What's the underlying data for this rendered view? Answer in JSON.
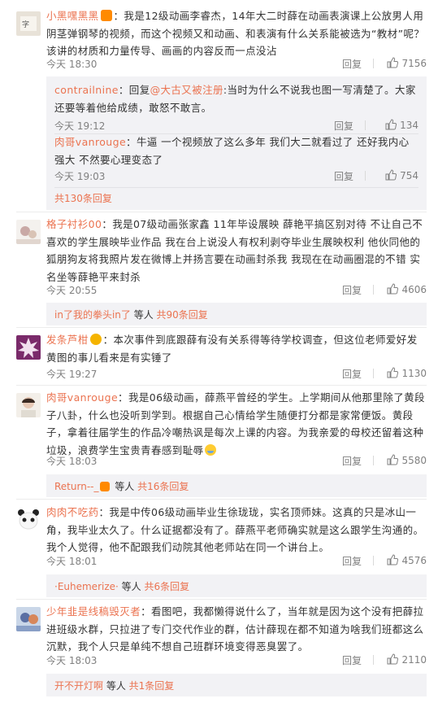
{
  "comments": [
    {
      "author": "小黑嘿黑黑",
      "text": "：我是12级动画李睿杰，14年大二时薛在动画表演课上公放男人用阴茎弹钢琴的视频，而这个视频又和动画、和表演有什么关系能被选为“教材”呢？该讲的材质和力量传导、画画的内容反而一点没沾",
      "time": "今天 18:30",
      "reply_label": "回复",
      "likes": "7156",
      "replies": [
        {
          "author": "contrailnine",
          "text": "：回复",
          "mention": "@大古又被注册",
          "text2": ":当时为什么不说我也图一写清楚了。大家还要等着他给成绩，敢怒不敢言。",
          "time": "今天 19:12",
          "reply_label": "回复",
          "likes": "134"
        },
        {
          "author": "肉哥vanrouge",
          "text": "：牛逼 一个视频放了这么多年 我们大二就看过了 还好我内心强大 不然要心理变态了",
          "time": "今天 19:03",
          "reply_label": "回复",
          "likes": "754"
        }
      ],
      "more": "共130条回复"
    },
    {
      "author": "格子衬衫00",
      "text": "：我是07级动画张家鑫 11年毕设展映 薛艳平搞区别对待 不让自己不喜欢的学生展映毕业作品 我在台上说没人有权利剥夺毕业生展映权利 他伙同他的狐朋狗友将我照片发在微博上并扬言要在动画封杀我 我现在在动画圈混的不错 实名坐等薛艳平来封杀",
      "time": "今天 20:55",
      "reply_label": "回复",
      "likes": "4606",
      "more_prefix": "in了我的拳头in了",
      "more_mid": " 等人 ",
      "more": "共90条回复"
    },
    {
      "author": "发条芦柑",
      "text": "：本次事件到底跟薛有没有关系得等待学校调查，但这位老师爱好发黄图的事儿看来是有实锤了",
      "time": "今天 19:27",
      "reply_label": "回复",
      "likes": "1130"
    },
    {
      "author": "肉哥vanrouge",
      "text": "：我是06级动画，薛燕平曾经的学生。上学期间从他那里除了黄段子八卦，什么也没听到学到。根据自己心情给学生随便打分都是家常便饭。黄段子，拿着往届学生的作品冷嘲热讽是每次上课的内容。为我亲爱的母校还留着这种垃圾，浪费学生宝贵青春感到耻辱",
      "time": "今天 18:03",
      "reply_label": "回复",
      "likes": "5580",
      "more_prefix": "Return--_",
      "more_mid": " 等人 ",
      "more": "共16条回复"
    },
    {
      "author": "肉肉不吃药",
      "text": "：我是中传06级动画毕业生徐珑珑，实名顶师妹。这真的只是冰山一角，我毕业太久了。什么证据都没有了。薛燕平老师确实就是这么跟学生沟通的。我个人觉得，他不配跟我们动院其他老师站在同一个讲台上。",
      "time": "今天 18:01",
      "reply_label": "回复",
      "likes": "4576",
      "more_prefix": "·Euhemerize·",
      "more_mid": " 等人 ",
      "more": "共6条回复"
    },
    {
      "author": "少年韭是线稿毁灭者",
      "text": "：看图吧，我都懒得说什么了，当年就是因为这个没有把薛拉进班级水群，只拉进了专门交代作业的群，估计薛现在都不知道为啥我们班都这么沉默，我个人只是单纯不想自己班群环境变得恶臭罢了。",
      "time": "今天 18:03",
      "reply_label": "回复",
      "likes": "2110",
      "more_prefix": "开不开灯啊",
      "more_mid": " 等人 ",
      "more": "共1条回复"
    }
  ],
  "colors": {
    "link": "#eb7350",
    "meta": "#808080",
    "reply_bg": "#f2f2f5",
    "text": "#333333"
  },
  "icons": [
    "thumb-up-icon",
    "vip-badge-icon",
    "emoji-icon"
  ]
}
